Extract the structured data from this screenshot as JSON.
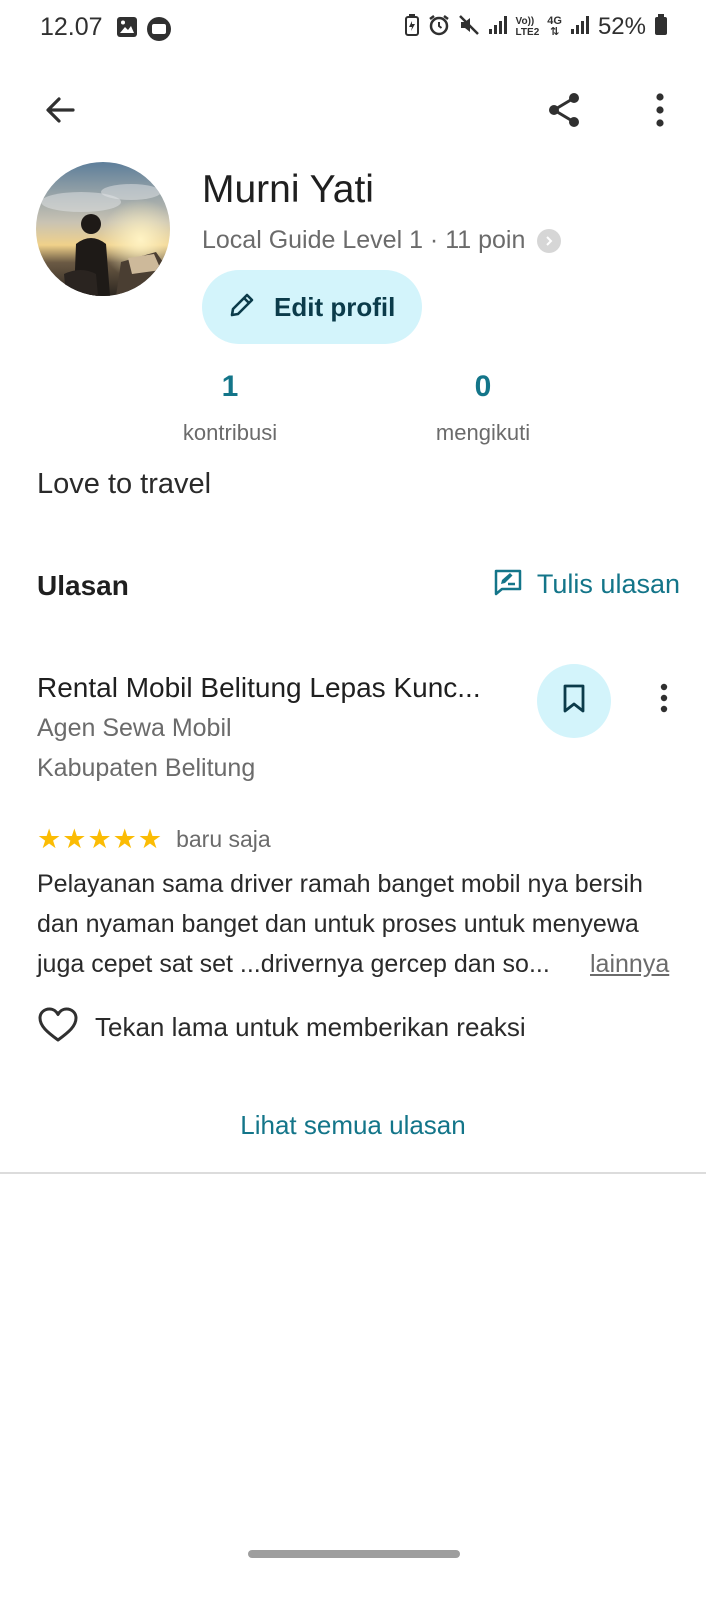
{
  "status_bar": {
    "time": "12.07",
    "battery_percent": "52%",
    "network_label_top": "Vo))",
    "network_label_bottom": "LTE2",
    "network_type": "4G"
  },
  "toolbar": {
    "back_icon": "arrow-left-icon",
    "share_icon": "share-icon",
    "more_icon": "more-vertical-icon"
  },
  "profile": {
    "name": "Murni Yati",
    "guide_level": "Local Guide Level 1 · 11 poin",
    "edit_label": "Edit profil",
    "contributions_count": "1",
    "contributions_label": "kontribusi",
    "following_count": "0",
    "following_label": "mengikuti",
    "bio": "Love to travel"
  },
  "reviews_section": {
    "title": "Ulasan",
    "write_review_label": "Tulis ulasan",
    "see_all_label": "Lihat semua ulasan"
  },
  "review": {
    "place_name": "Rental Mobil Belitung Lepas Kunc...",
    "category": "Agen Sewa Mobil",
    "location": "Kabupaten Belitung",
    "rating": 5,
    "time": "baru saja",
    "text_lines": [
      "Pelayanan sama driver ramah banget mobil nya bersih",
      "dan nyaman banget dan untuk proses untuk menyewa",
      "juga cepet sat set ...drivernya gercep dan so..."
    ],
    "more_label": "lainnya",
    "reaction_hint": "Tekan lama untuk memberikan reaksi"
  },
  "colors": {
    "accent": "#137589",
    "chip_bg": "#d3f4fb",
    "star": "#fbbc04"
  }
}
